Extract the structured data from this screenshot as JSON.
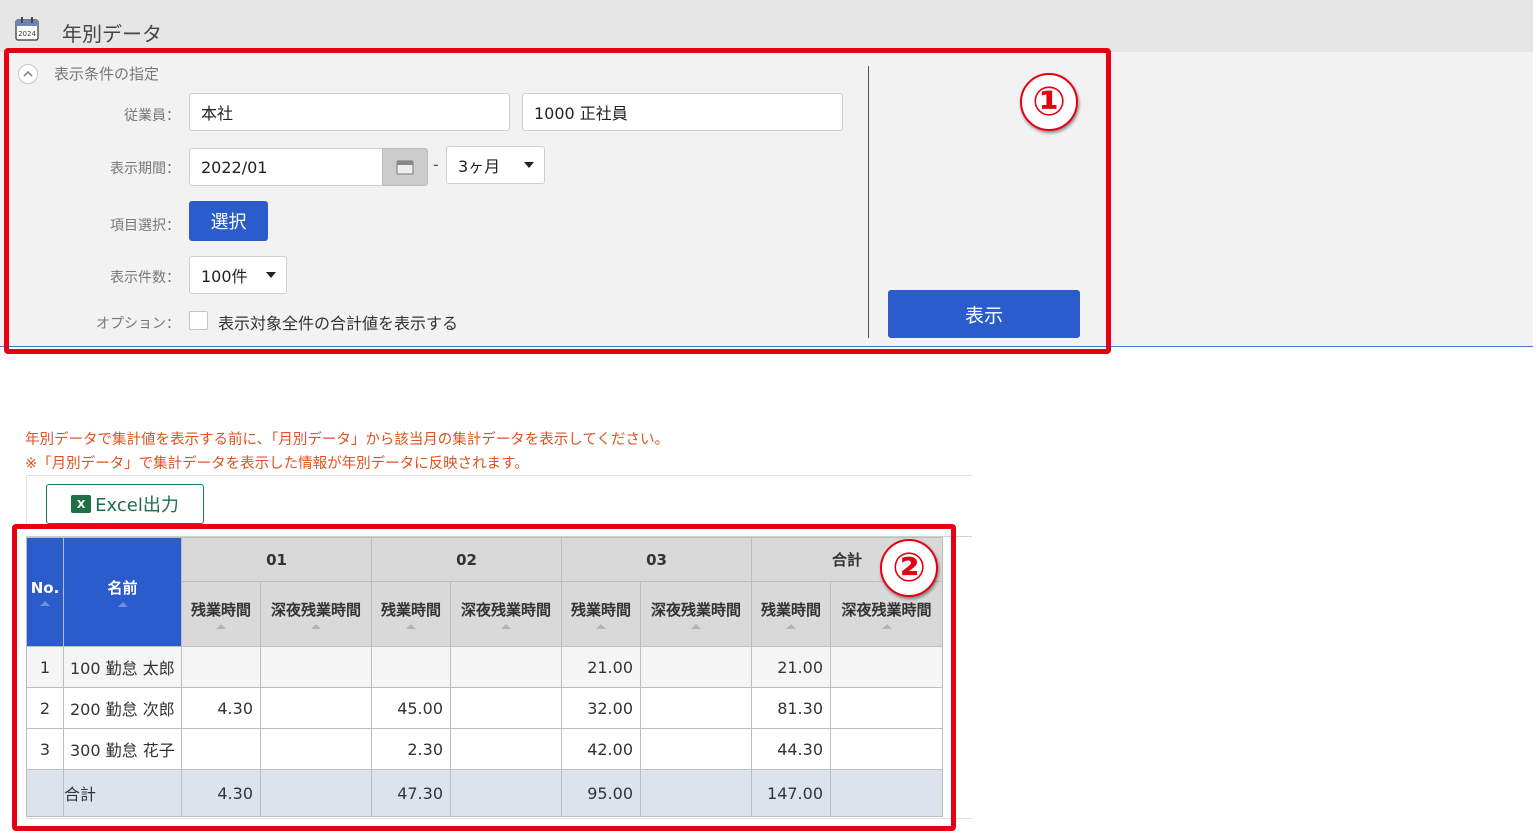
{
  "header": {
    "title": "年別データ",
    "icon_text": "2024",
    "icon": "calendar-icon"
  },
  "conditions": {
    "title": "表示条件の指定",
    "employee_label": "従業員：",
    "employee_company": "本社",
    "employee_type": "1000 正社員",
    "period_label": "表示期間：",
    "period_start": "2022/01",
    "period_separator": "-",
    "period_length": "3ヶ月",
    "item_label": "項目選択：",
    "select_button": "選択",
    "count_label": "表示件数：",
    "count_value": "100件",
    "option_label": "オプション：",
    "option_text": "表示対象全件の合計値を表示する",
    "option_checked": false,
    "show_button": "表示"
  },
  "annotations": {
    "circle1": "①",
    "circle2": "②",
    "color": "#e60012"
  },
  "notice": {
    "line1": "年別データで集計値を表示する前に、「月別データ」から該当月の集計データを表示してください。",
    "line2": "※「月別データ」で集計データを表示した情報が年別データに反映されます。",
    "color": "#e0531d"
  },
  "excel_button": "Excel出力",
  "excel_icon": "X",
  "table": {
    "headers": {
      "no": "No.",
      "name": "名前",
      "groups": [
        "01",
        "02",
        "03",
        "合計"
      ],
      "sub": [
        "残業時間",
        "深夜残業時間"
      ]
    },
    "rows": [
      {
        "no": "1",
        "name": "100 勤怠 太郎",
        "values": [
          "",
          "",
          "",
          "",
          "21.00",
          "",
          "21.00",
          ""
        ]
      },
      {
        "no": "2",
        "name": "200 勤怠 次郎",
        "values": [
          "4.30",
          "",
          "45.00",
          "",
          "32.00",
          "",
          "81.30",
          ""
        ]
      },
      {
        "no": "3",
        "name": "300 勤怠 花子",
        "values": [
          "",
          "",
          "2.30",
          "",
          "42.00",
          "",
          "44.30",
          ""
        ]
      }
    ],
    "total": {
      "label": "合計",
      "values": [
        "4.30",
        "",
        "47.30",
        "",
        "95.00",
        "",
        "147.00",
        ""
      ]
    }
  },
  "colors": {
    "primary": "#2b5ccc",
    "header_bg": "#e6e6e6",
    "panel_bg": "#f2f2f2"
  }
}
